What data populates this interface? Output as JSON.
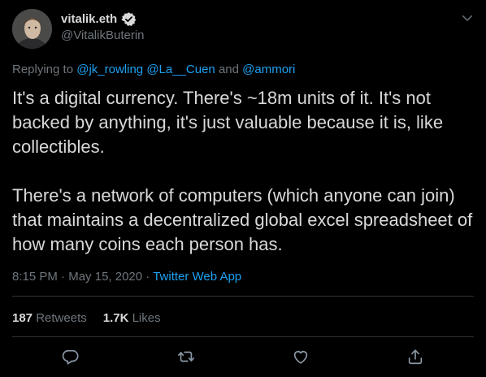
{
  "author": {
    "display_name": "vitalik.eth",
    "handle": "@VitalikButerin",
    "verified": true,
    "avatar_icon": "avatar-photo"
  },
  "reply": {
    "prefix": "Replying to ",
    "mention_1": "@jk_rowling",
    "mention_2": "@La__Cuen",
    "and": " and ",
    "mention_3": "@ammori"
  },
  "tweet": {
    "paragraph_1": "It's a digital currency. There's ~18m units of it. It's not backed by anything, it's just valuable because it is, like collectibles.",
    "paragraph_2": "There's a network of computers (which anyone can join) that maintains a decentralized global excel spreadsheet of how many coins each person has."
  },
  "meta": {
    "time": "8:15 PM",
    "separator": " · ",
    "date": "May 15, 2020",
    "source": "Twitter Web App"
  },
  "stats": {
    "retweets_count": "187",
    "retweets_label": "Retweets",
    "likes_count": "1.7K",
    "likes_label": "Likes"
  },
  "actions": {
    "reply_icon": "reply-icon",
    "retweet_icon": "retweet-icon",
    "like_icon": "heart-icon",
    "share_icon": "share-icon",
    "menu_icon": "chevron-down-icon"
  },
  "colors": {
    "background": "#000000",
    "text": "#d9d9d9",
    "secondary": "#6e767d",
    "accent": "#1da1f2",
    "divider": "#2f3336"
  }
}
